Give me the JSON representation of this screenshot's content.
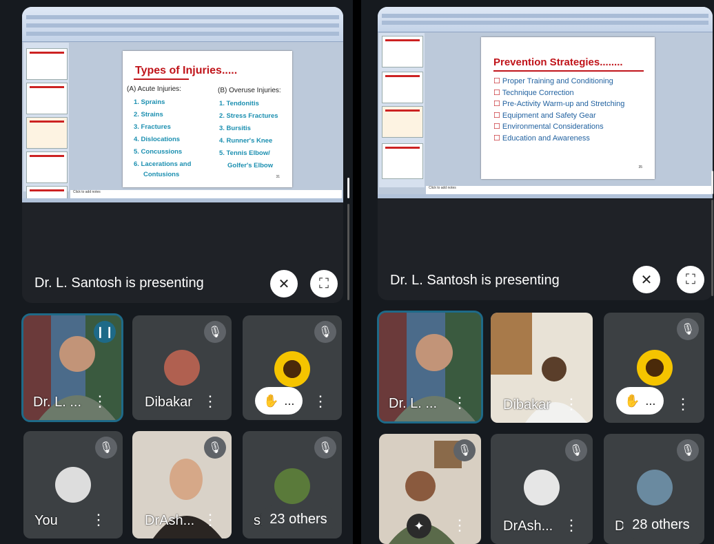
{
  "left": {
    "slide": {
      "title": "Types of Injuries.....",
      "col_a_heading": "(A) Acute Injuries:",
      "col_b_heading": "(B) Overuse Injuries:",
      "acute": [
        "1. Sprains",
        "2. Strains",
        "3. Fractures",
        "4. Dislocations",
        "5. Concussions",
        "6. Lacerations and",
        "Contusions"
      ],
      "overuse": [
        "1. Tendonitis",
        "2. Stress Fractures",
        "3. Bursitis",
        "4. Runner's Knee",
        "5. Tennis Elbow/",
        "Golfer's Elbow"
      ],
      "page": "31"
    },
    "notes": "Click to add notes",
    "presenting": "Dr. L. Santosh is presenting",
    "tiles": {
      "t1": "Dr. L. ...",
      "t2": "Dibakar",
      "t4": "You",
      "t5": "DrAsh...",
      "t6_prefix": "sh",
      "others": "23 others",
      "hand_more": "..."
    }
  },
  "right": {
    "slide": {
      "title": "Prevention Strategies........",
      "items": [
        "Proper Training and Conditioning",
        "Technique Correction",
        "Pre-Activity Warm-up and Stretching",
        "Equipment and Safety Gear",
        "Environmental Considerations",
        "Education and Awareness"
      ],
      "page": "35"
    },
    "notes": "Click to add notes",
    "presenting": "Dr. L. Santosh is presenting",
    "tiles": {
      "t1": "Dr. L. ...",
      "t2": "Dibakar",
      "t5": "DrAsh...",
      "t6_prefix": "Dr",
      "others": "28 others",
      "hand_more": "..."
    }
  },
  "colors": {
    "accent": "#1e6a88",
    "tile_bg": "#3c4043",
    "slide_title": "#c0141a",
    "slide_text": "#1b8fb0"
  },
  "icons": [
    "pin-off-icon",
    "fullscreen-icon",
    "mic-off-icon",
    "audio-wave-icon",
    "hand-raised-icon",
    "more-vert-icon",
    "sparkle-icon"
  ]
}
